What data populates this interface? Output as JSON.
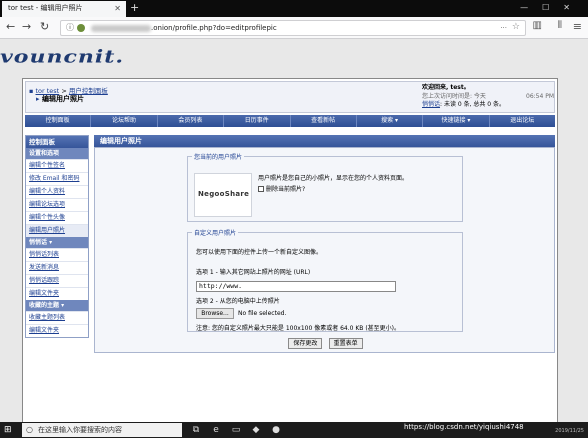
{
  "browser": {
    "tab_title": "tor test - 编辑用户照片",
    "url_text": ".onion/profile.php?do=editprofilepic",
    "menu_dots": "···"
  },
  "site": {
    "logo_text": "vouncnit."
  },
  "breadcrumb": {
    "root": "tor test",
    "sep": ">",
    "parent": "用户控制面板",
    "current": "编辑用户照片"
  },
  "welcome": {
    "greeting": "欢迎回来, test。",
    "last_visit_label": "您上次访问时间是: 今天",
    "last_visit_time": "06:54 PM",
    "pm_link": "悄悄话",
    "pm_status": ": 未读 0 条, 总共 0 条。"
  },
  "menubar": [
    "控制面板",
    "论坛帮助",
    "会员列表",
    "日历事件",
    "查看新帖",
    "搜索 ▾",
    "快速链接 ▾",
    "退出论坛"
  ],
  "sidebar": {
    "panel_title": "控制面板",
    "section1_title": "设置和选项",
    "section1_items": [
      "编辑个性签名",
      "修改 Email 和密码",
      "编辑个人资料",
      "编辑论坛选项",
      "编辑个性头像",
      "编辑用户照片"
    ],
    "section2_title": "悄悄话 ▾",
    "section2_items": [
      "悄悄话列表",
      "发送新消息",
      "悄悄话跟踪",
      "编辑文件夹"
    ],
    "section3_title": "收藏的主题 ▾",
    "section3_items": [
      "收藏主题列表",
      "编辑文件夹"
    ]
  },
  "main": {
    "heading": "编辑用户照片",
    "current_legend": "您当前的用户照片",
    "current_logo": "NegooShare",
    "current_desc": "用户照片是您自己的小照片，显示在您的个人资料页面。",
    "delete_label": "删除当前照片?",
    "custom_legend": "自定义用户照片",
    "custom_intro": "您可以使用下面的控件上传一个新自定义图像。",
    "option1_label": "选项 1 - 输入其它网站上照片的网址 (URL)",
    "url_value": "http://www.",
    "option2_label": "选项 2 - 从您的电脑中上传照片",
    "browse_label": "Browse...",
    "nofile_label": "No file selected.",
    "note": "注意: 您的自定义照片最大只能是 100x100 像素或者 64.0 KB (甚至更小)。",
    "save_label": "保存更改",
    "reset_label": "重置表单"
  },
  "taskbar": {
    "search_placeholder": "在这里输入你要搜索的内容",
    "watermark": "https://blog.csdn.net/yiqiushi4748",
    "date": "2019/11/25"
  }
}
